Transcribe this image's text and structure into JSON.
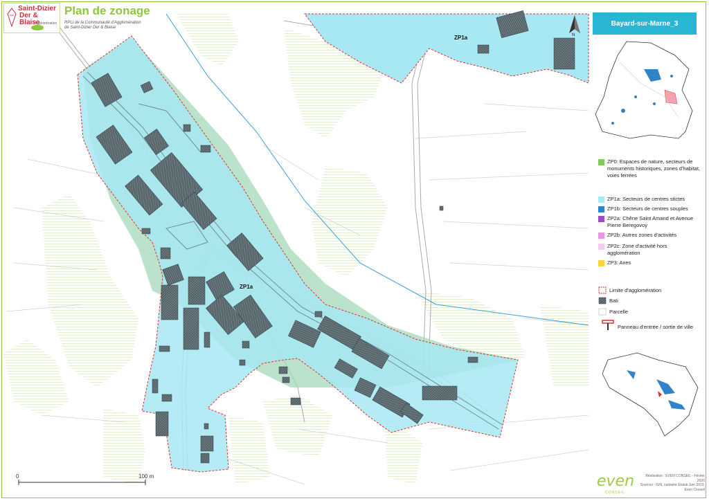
{
  "header": {
    "logo_line1": "Saint-Dizier",
    "logo_line2": "Der & Blaise",
    "logo_line3": "Agglomération",
    "title": "Plan de zonage",
    "subtitle_line1": "RPLI de la Communauté d'Agglomération",
    "subtitle_line2": "de Saint-Dizier Der & Blaise"
  },
  "commune_name": "Bayard-sur-Marne_3",
  "map_labels": {
    "zone_a": "ZP1a",
    "zone_b": "ZP1a",
    "north": "N"
  },
  "scale": {
    "start": "0",
    "end": "100 m"
  },
  "legend": {
    "items": [
      {
        "label": "ZP0: Espaces de nature, secteurs de monuments historiques, zones d'habitat, voies ferrées",
        "color": "#7dc95e"
      },
      {
        "label": "ZP1a: Secteurs de centres stictes",
        "color": "#a7e8f2"
      },
      {
        "label": "ZP1b: Secteurs de centres souples",
        "color": "#2f83c6"
      },
      {
        "label": "ZP2a: Chêne Saint Amand et Avenue Pierre Beregovoy",
        "color": "#9a4fc9"
      },
      {
        "label": "ZP2b: Autres zones d'activités",
        "color": "#e995e6"
      },
      {
        "label": "ZP2c: Zone d'activité hors agglomération",
        "color": "#f7c9ec"
      },
      {
        "label": "ZP3: Axes",
        "color": "#f7d43d"
      }
    ],
    "boundary_label": "Limite d'agglomération",
    "building_label": "Bati",
    "parcel_label": "Parcelle",
    "sign_label": "Panneau d'entrée / sortie de ville"
  },
  "footer": {
    "credit_line1": "Réalisation : EVEN CONSEIL - Février 2020",
    "credit_line2": "Sources : IGN, cadastre Etalab Juin 2019,",
    "credit_line3": "Even Conseil",
    "brand": "even",
    "brand_sub": "CONSEIL"
  },
  "colors": {
    "zp1a": "#a7e8f2",
    "nature_buffer": "#9ed7b5",
    "hatch_green": "#cfe3b4",
    "boundary": "#d9342b",
    "accent": "#8ec63f"
  }
}
